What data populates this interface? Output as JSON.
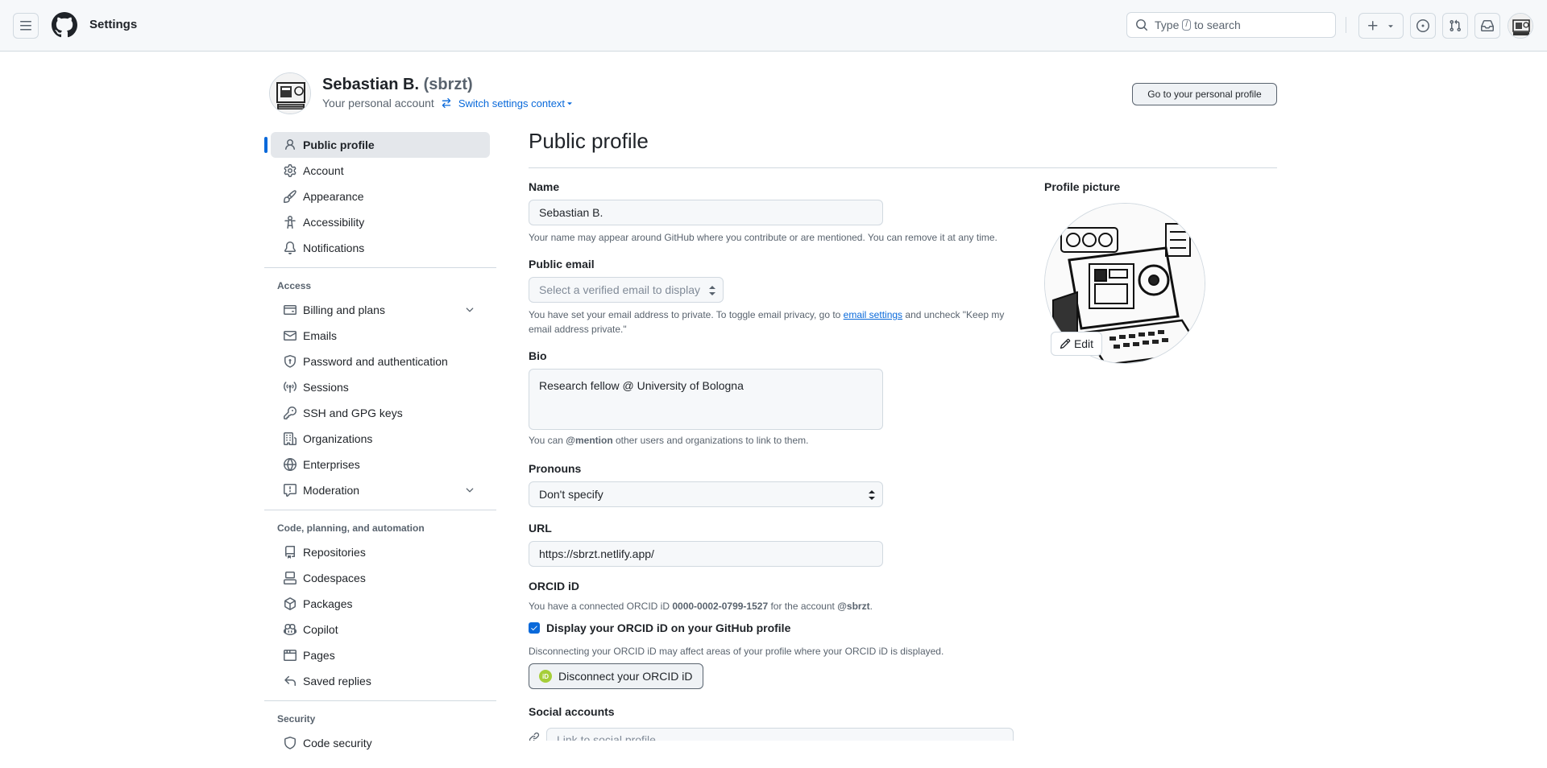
{
  "header": {
    "title": "Settings",
    "search_prefix": "Type",
    "search_key": "/",
    "search_suffix": "to search"
  },
  "context": {
    "name": "Sebastian B.",
    "login": "(sbrzt)",
    "subtitle": "Your personal account",
    "switch_label": "Switch settings context",
    "profile_button": "Go to your personal profile"
  },
  "sidebar": {
    "items_top": [
      {
        "label": "Public profile",
        "icon": "person-icon",
        "active": true
      },
      {
        "label": "Account",
        "icon": "gear-icon"
      },
      {
        "label": "Appearance",
        "icon": "paintbrush-icon"
      },
      {
        "label": "Accessibility",
        "icon": "accessibility-icon"
      },
      {
        "label": "Notifications",
        "icon": "bell-icon"
      }
    ],
    "access_heading": "Access",
    "items_access": [
      {
        "label": "Billing and plans",
        "icon": "credit-card-icon",
        "expandable": true
      },
      {
        "label": "Emails",
        "icon": "mail-icon"
      },
      {
        "label": "Password and authentication",
        "icon": "shield-lock-icon"
      },
      {
        "label": "Sessions",
        "icon": "broadcast-icon"
      },
      {
        "label": "SSH and GPG keys",
        "icon": "key-icon"
      },
      {
        "label": "Organizations",
        "icon": "organization-icon"
      },
      {
        "label": "Enterprises",
        "icon": "globe-icon"
      },
      {
        "label": "Moderation",
        "icon": "report-icon",
        "expandable": true
      }
    ],
    "code_heading": "Code, planning, and automation",
    "items_code": [
      {
        "label": "Repositories",
        "icon": "repo-icon"
      },
      {
        "label": "Codespaces",
        "icon": "codespaces-icon"
      },
      {
        "label": "Packages",
        "icon": "package-icon"
      },
      {
        "label": "Copilot",
        "icon": "copilot-icon"
      },
      {
        "label": "Pages",
        "icon": "browser-icon"
      },
      {
        "label": "Saved replies",
        "icon": "reply-icon"
      }
    ],
    "security_heading": "Security",
    "items_security": [
      {
        "label": "Code security",
        "icon": "shield-icon"
      }
    ]
  },
  "main": {
    "title": "Public profile",
    "name_label": "Name",
    "name_value": "Sebastian B.",
    "name_hint": "Your name may appear around GitHub where you contribute or are mentioned. You can remove it at any time.",
    "email_label": "Public email",
    "email_select": "Select a verified email to display",
    "email_hint_pre": "You have set your email address to private. To toggle email privacy, go to",
    "email_hint_link": "email settings",
    "email_hint_post": "and uncheck \"Keep my email address private.\"",
    "bio_label": "Bio",
    "bio_value": "Research fellow @ University of Bologna",
    "bio_hint_pre": "You can",
    "bio_hint_mention": "@mention",
    "bio_hint_post": "other users and organizations to link to them.",
    "pronouns_label": "Pronouns",
    "pronouns_value": "Don't specify",
    "url_label": "URL",
    "url_value": "https://sbrzt.netlify.app/",
    "orcid_label": "ORCID iD",
    "orcid_hint_pre": "You have a connected ORCID iD",
    "orcid_id": "0000-0002-0799-1527",
    "orcid_hint_mid": "for the account",
    "orcid_account": "@sbrzt",
    "orcid_checkbox": "Display your ORCID iD on your GitHub profile",
    "orcid_disconnect_hint": "Disconnecting your ORCID iD may affect areas of your profile where your ORCID iD is displayed.",
    "orcid_button": "Disconnect your ORCID iD",
    "orcid_badge": "iD",
    "social_label": "Social accounts",
    "social_placeholder": "Link to social profile",
    "picture_label": "Profile picture",
    "edit_label": "Edit"
  },
  "colors": {
    "accent": "#0969da",
    "orcid": "#a6ce39"
  }
}
